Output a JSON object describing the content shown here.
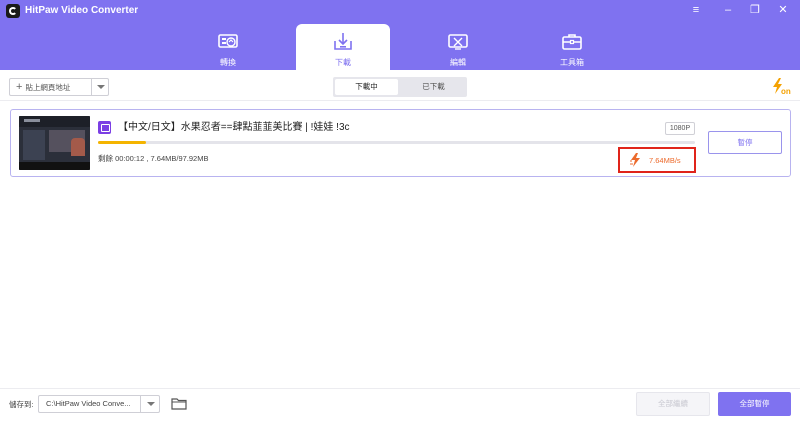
{
  "app": {
    "title": "HitPaw Video Converter"
  },
  "window_controls": [
    {
      "name": "menu-icon",
      "glyph": "≡"
    },
    {
      "name": "minimize-icon",
      "glyph": "–"
    },
    {
      "name": "restore-icon",
      "glyph": "❐"
    },
    {
      "name": "close-icon",
      "glyph": "✕"
    }
  ],
  "tabs": [
    {
      "label": "轉換",
      "icon": "convert-icon",
      "active": false
    },
    {
      "label": "下載",
      "icon": "download-icon",
      "active": true
    },
    {
      "label": "編輯",
      "icon": "edit-icon",
      "active": false
    },
    {
      "label": "工具箱",
      "icon": "toolbox-icon",
      "active": false
    }
  ],
  "toolbar": {
    "paste_url_label": "貼上網頁地址",
    "segment": {
      "downloading": "下載中",
      "downloaded": "已下載",
      "active": "downloading"
    },
    "turbo_badge": "on"
  },
  "download_item": {
    "title": "【中文/日文】水果忍者==肆點韮韮美比賽 | !娃娃 !3c",
    "quality": "1080P",
    "progress": 0.08,
    "remaining": "剩餘 00:00:12 , 7.64MB/97.92MB",
    "speed": "7.64MB/s",
    "pause_label": "暫停",
    "platform_icon": "twitch-icon"
  },
  "footer": {
    "save_to_label": "儲存到:",
    "save_path": "C:\\HitPaw Video Conve...",
    "resume_all_label": "全部繼續",
    "pause_all_label": "全部暫停"
  },
  "colors": {
    "accent": "#7f72f0",
    "progress": "#f4b400",
    "speed_text": "#ec6a2c",
    "highlight_border": "#e0241a"
  }
}
